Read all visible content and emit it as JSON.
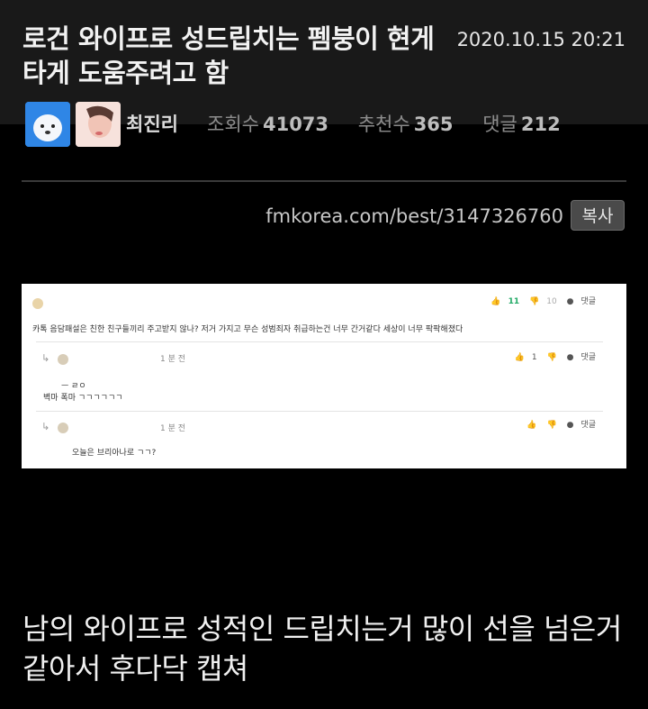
{
  "post": {
    "title": "로건 와이프로 성드립치는 펨붕이 현게 타게 도움주려고 함",
    "date": "2020.10.15 20:21",
    "author": "최진리",
    "views_label": "조회수",
    "views": "41073",
    "recommend_label": "추천수",
    "recommend": "365",
    "comments_label": "댓글",
    "comments": "212"
  },
  "share": {
    "url": "fmkorea.com/best/3147326760",
    "copy_label": "복사"
  },
  "screenshot": {
    "reply_label": "댓글",
    "comment_main": {
      "up": "11",
      "down": "10",
      "text": "카톡 음담패설은 친한 친구들끼리 주고받지 않나? 저거 가지고 무슨 성범죄자 취급하는건 너무 간거같다 세상이 너무 팍팍해졌다"
    },
    "reply_1": {
      "time": "1 분 전",
      "up": "1",
      "line1": "ㅡ ㄹㅇ",
      "line2": "벽마 폭마 ㄱㄱㄱㄱㄱㄱ"
    },
    "reply_2": {
      "time": "1 분 전",
      "text": "오늘은 브리아나로 ㄱㄱ?"
    }
  },
  "body_text": "남의 와이프로 성적인 드립치는거 많이 선을 넘은거 같아서 후다닥 캡쳐",
  "colors": {
    "background": "#000000",
    "header": "#191919",
    "copy_button": "#4a4a4a"
  }
}
